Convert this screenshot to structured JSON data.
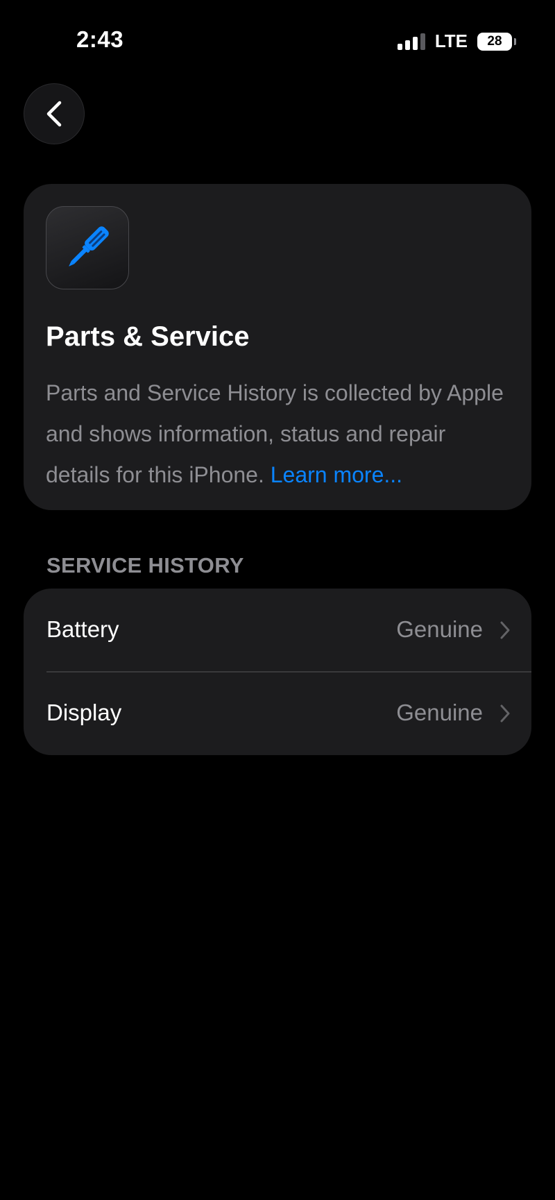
{
  "status_bar": {
    "time": "2:43",
    "network": "LTE",
    "battery_level": "28",
    "signal_bars_active": 3,
    "signal_bars_total": 4
  },
  "navigation": {
    "back_icon": "chevron-left-icon"
  },
  "info_card": {
    "icon": "screwdriver-icon",
    "icon_color": "#0a84ff",
    "title": "Parts & Service",
    "description": "Parts and Service History is collected by Apple and shows information, status and repair details for this iPhone.",
    "learn_more": "Learn more..."
  },
  "service_history": {
    "header": "SERVICE HISTORY",
    "items": [
      {
        "label": "Battery",
        "value": "Genuine"
      },
      {
        "label": "Display",
        "value": "Genuine"
      }
    ]
  },
  "colors": {
    "background": "#000000",
    "card": "#1c1c1e",
    "secondary_text": "#8e8e93",
    "accent": "#0a84ff"
  }
}
